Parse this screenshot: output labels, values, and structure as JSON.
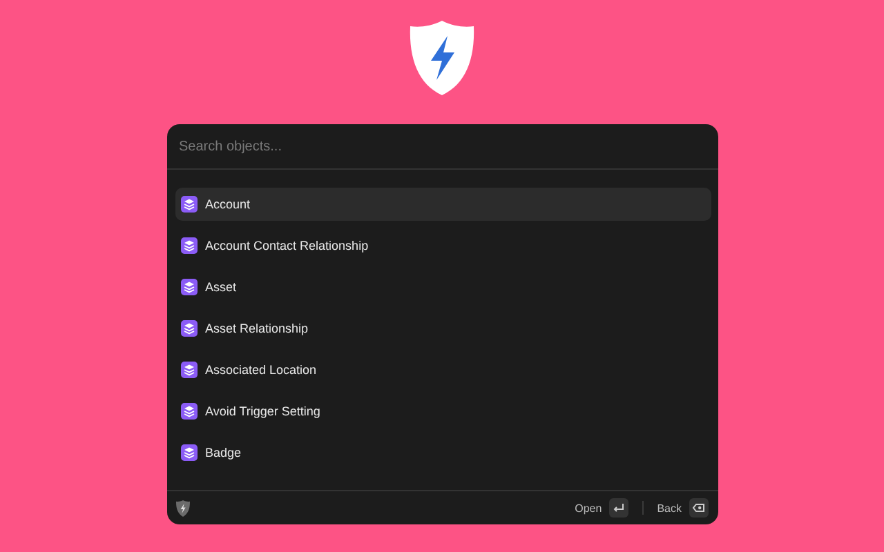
{
  "search": {
    "placeholder": "Search objects..."
  },
  "items": [
    {
      "label": "Account",
      "selected": true
    },
    {
      "label": "Account Contact Relationship",
      "selected": false
    },
    {
      "label": "Asset",
      "selected": false
    },
    {
      "label": "Asset Relationship",
      "selected": false
    },
    {
      "label": "Associated Location",
      "selected": false
    },
    {
      "label": "Avoid Trigger Setting",
      "selected": false
    },
    {
      "label": "Badge",
      "selected": false
    }
  ],
  "footer": {
    "actions": [
      {
        "label": "Open",
        "kind": "enter"
      },
      {
        "label": "Back",
        "kind": "backspace"
      }
    ]
  }
}
